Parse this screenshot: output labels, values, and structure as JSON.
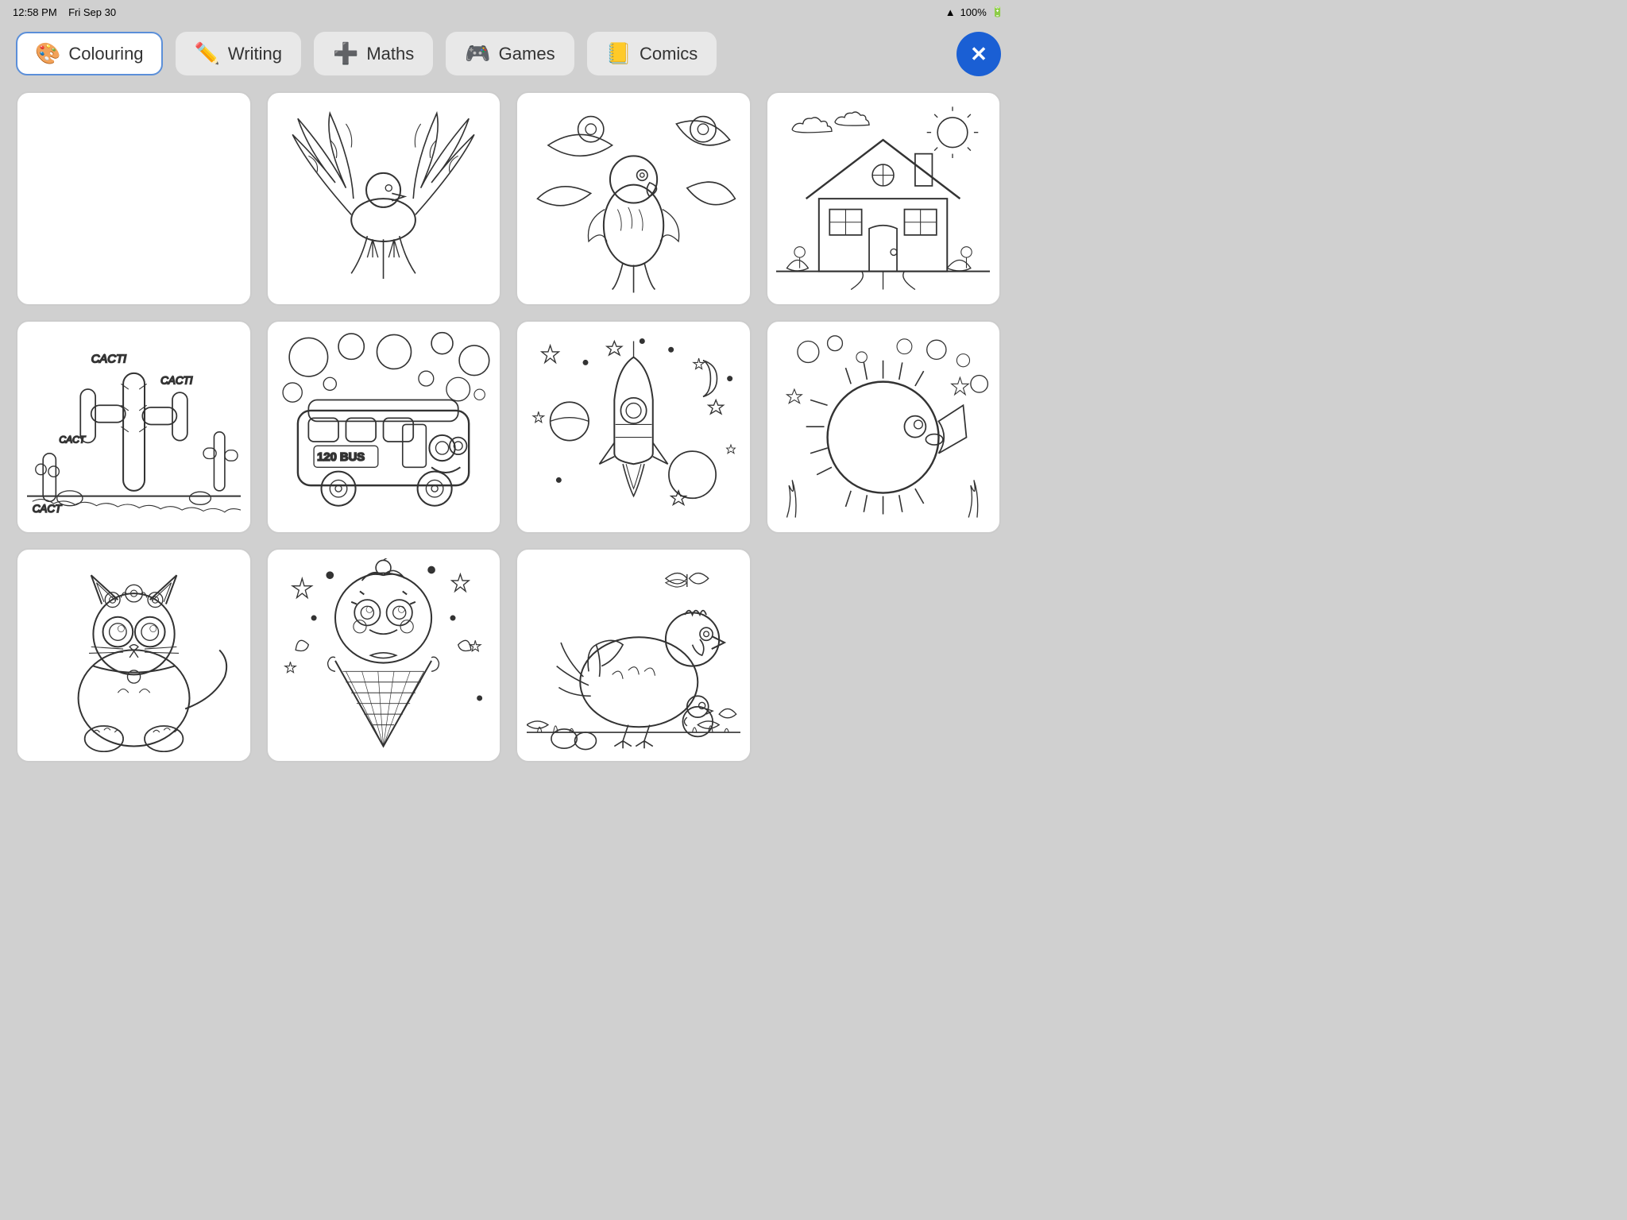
{
  "statusBar": {
    "time": "12:58 PM",
    "date": "Fri Sep 30",
    "battery": "100%",
    "wifi": true
  },
  "tabs": [
    {
      "id": "colouring",
      "label": "Colouring",
      "icon": "🎨",
      "active": true
    },
    {
      "id": "writing",
      "label": "Writing",
      "icon": "✏️",
      "active": false
    },
    {
      "id": "maths",
      "label": "Maths",
      "icon": "➕",
      "active": false
    },
    {
      "id": "games",
      "label": "Games",
      "icon": "🎮",
      "active": false
    },
    {
      "id": "comics",
      "label": "Comics",
      "icon": "📒",
      "active": false
    }
  ],
  "closeButton": "✕",
  "grid": {
    "items": [
      {
        "id": "blank",
        "type": "blank",
        "label": "Blank canvas"
      },
      {
        "id": "eagle",
        "type": "drawing",
        "label": "Eagle"
      },
      {
        "id": "parrot",
        "type": "drawing",
        "label": "Parrot"
      },
      {
        "id": "house",
        "type": "drawing",
        "label": "House"
      },
      {
        "id": "cactus",
        "type": "drawing",
        "label": "Cactus"
      },
      {
        "id": "bus",
        "type": "drawing",
        "label": "Bus with bubbles"
      },
      {
        "id": "rocket",
        "type": "drawing",
        "label": "Rocket in space"
      },
      {
        "id": "fish",
        "type": "drawing",
        "label": "Fish underwater"
      },
      {
        "id": "cat",
        "type": "drawing",
        "label": "Cat with flowers"
      },
      {
        "id": "icecream",
        "type": "drawing",
        "label": "Ice cream character"
      },
      {
        "id": "chicken",
        "type": "drawing",
        "label": "Chicken and chick"
      },
      {
        "id": "empty",
        "type": "empty",
        "label": ""
      }
    ]
  }
}
